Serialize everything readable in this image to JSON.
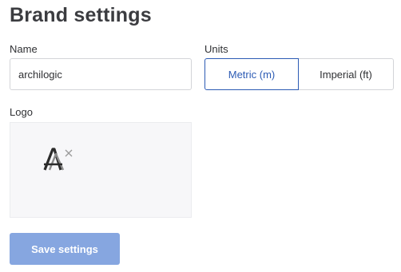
{
  "page": {
    "title": "Brand settings"
  },
  "name_field": {
    "label": "Name",
    "value": "archilogic"
  },
  "units": {
    "label": "Units",
    "options": [
      "Metric (m)",
      "Imperial (ft)"
    ],
    "selected": "Metric (m)"
  },
  "logo": {
    "label": "Logo",
    "image_lettering": "A",
    "remove_icon": "close-icon"
  },
  "actions": {
    "save_label": "Save settings"
  },
  "colors": {
    "accent": "#2c5bb4",
    "save_button_bg": "#86a6e0",
    "logo_box_bg": "#f7f7f9",
    "border": "#d3d4d8"
  }
}
